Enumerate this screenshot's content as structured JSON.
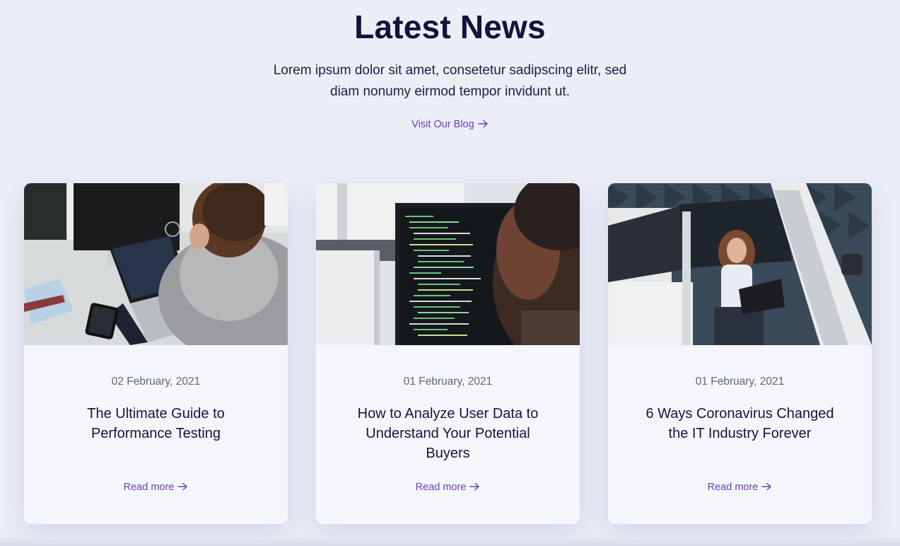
{
  "header": {
    "title": "Latest News",
    "subtitle_lines": [
      "Lorem ipsum dolor sit amet, consetetur sadipscing elitr, sed",
      "diam nonumy eirmod tempor invidunt ut."
    ],
    "blog_link": "Visit Our Blog"
  },
  "cards": [
    {
      "date": "02 February, 2021",
      "title_lines": [
        "The Ultimate Guide to",
        "Performance Testing"
      ],
      "read_more": "Read more",
      "image_icon": "man-laptop-photo"
    },
    {
      "date": "01 February, 2021",
      "title_lines": [
        "How to Analyze User Data to",
        "Understand Your Potential",
        "Buyers"
      ],
      "read_more": "Read more",
      "image_icon": "code-monitor-photo"
    },
    {
      "date": "01 February, 2021",
      "title_lines": [
        "6 Ways Coronavirus Changed",
        "the IT Industry Forever"
      ],
      "read_more": "Read more",
      "image_icon": "woman-car-laptop-photo"
    }
  ],
  "colors": {
    "background": "#eceef6",
    "heading": "#14133d",
    "accent": "#6a3cc4",
    "card": "#f5f6fb",
    "date": "#62657c"
  }
}
